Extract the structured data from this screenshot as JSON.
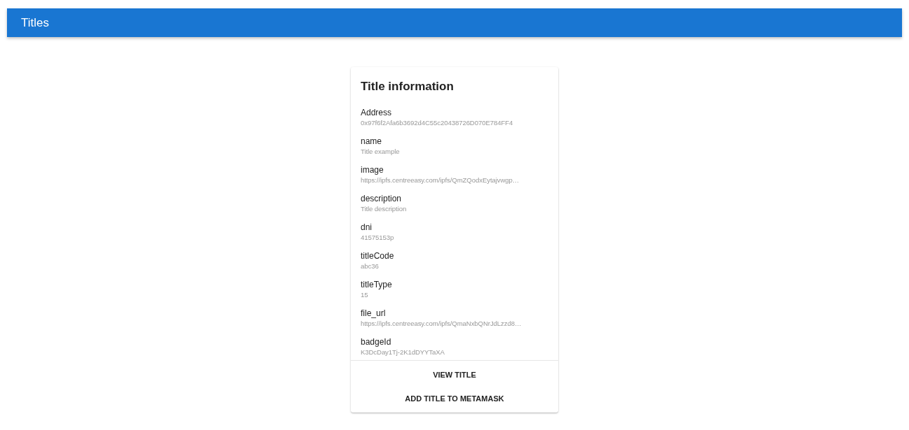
{
  "app_bar": {
    "title": "Titles"
  },
  "card": {
    "title": "Title information",
    "fields": [
      {
        "label": "Address",
        "value": "0x97f6f2Afa6b3692d4C55c20438726D070E784FF4"
      },
      {
        "label": "name",
        "value": "Title example"
      },
      {
        "label": "image",
        "value": "https://ipfs.centreeasy.com/ipfs/QmZQodxEytajvwgp…"
      },
      {
        "label": "description",
        "value": "Title description"
      },
      {
        "label": "dni",
        "value": "41575153p"
      },
      {
        "label": "titleCode",
        "value": "abc36"
      },
      {
        "label": "titleType",
        "value": "15"
      },
      {
        "label": "file_url",
        "value": "https://ipfs.centreeasy.com/ipfs/QmaNxbQNrJdLzzd8…"
      },
      {
        "label": "badgeId",
        "value": "K3DcDay1Tj-2K1dDYYTaXA"
      }
    ],
    "actions": [
      "VIEW TITLE",
      "ADD TITLE TO METAMASK"
    ]
  }
}
